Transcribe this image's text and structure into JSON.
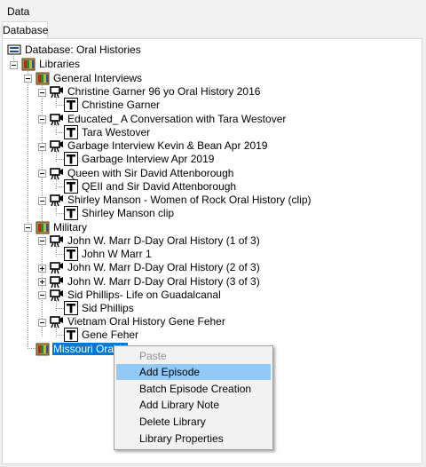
{
  "window": {
    "title": "Data"
  },
  "tabs": [
    {
      "label": "Database"
    }
  ],
  "tree": {
    "root": "Database: Oral Histories",
    "libraries_label": "Libraries",
    "general": "General Interviews",
    "g1": "Christine Garner 96 yo Oral History 2016",
    "g1t": "Christine Garner",
    "g2": "Educated_ A Conversation with Tara Westover",
    "g2t": "Tara Westover",
    "g3": "Garbage Interview Kevin & Bean Apr 2019",
    "g3t": "Garbage Interview Apr 2019",
    "g4": "Queen with Sir David Attenborough",
    "g4t": "QEII and Sir David Attenborough",
    "g5": "Shirley Manson - Women of Rock Oral History (clip)",
    "g5t": "Shirley Manson clip",
    "military": "Military",
    "m1": "John W. Marr D-Day Oral History (1 of 3)",
    "m1t": "John W Marr 1",
    "m2": "John W. Marr D-Day Oral History (2 of 3)",
    "m3": "John W. Marr D-Day Oral History (3 of 3)",
    "m4": "Sid Phillips- Life on Guadalcanal",
    "m4t": "Sid Phillips",
    "m5": "Vietnam Oral History Gene Feher",
    "m5t": "Gene Feher",
    "missouri": "Missouri Oral H"
  },
  "context_menu": {
    "items": [
      {
        "label": "Paste",
        "disabled": true
      },
      {
        "label": "Add Episode",
        "hover": true
      },
      {
        "label": "Batch Episode Creation"
      },
      {
        "label": "Add Library Note"
      },
      {
        "label": "Delete Library"
      },
      {
        "label": "Library Properties"
      }
    ]
  },
  "colors": {
    "selection": "#0078d7",
    "menu_hover": "#91c9f7",
    "menu_bg": "#f2f2f2"
  },
  "icons": [
    "database-icon",
    "library-icon",
    "episode-camera-icon",
    "transcript-icon"
  ]
}
